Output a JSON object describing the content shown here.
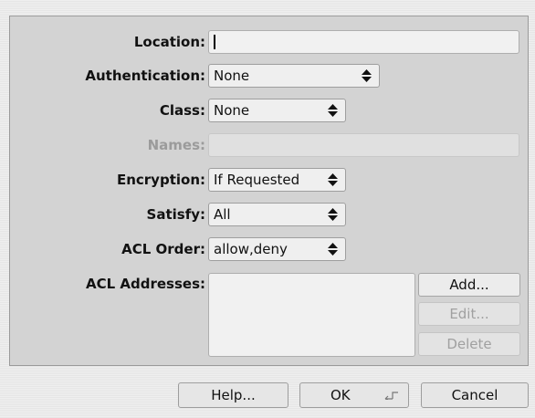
{
  "form": {
    "location": {
      "label": "Location:",
      "value": ""
    },
    "authentication": {
      "label": "Authentication:",
      "value": "None"
    },
    "class": {
      "label": "Class:",
      "value": "None"
    },
    "names": {
      "label": "Names:",
      "value": ""
    },
    "encryption": {
      "label": "Encryption:",
      "value": "If Requested"
    },
    "satisfy": {
      "label": "Satisfy:",
      "value": "All"
    },
    "acl_order": {
      "label": "ACL Order:",
      "value": "allow,deny"
    },
    "acl_addresses": {
      "label": "ACL Addresses:",
      "items": []
    }
  },
  "acl_buttons": {
    "add": "Add...",
    "edit": "Edit...",
    "delete": "Delete"
  },
  "footer": {
    "help": "Help...",
    "ok": "OK",
    "cancel": "Cancel"
  },
  "icons": {
    "popup": "updown-arrows-icon",
    "default_button": "return-key-icon"
  }
}
